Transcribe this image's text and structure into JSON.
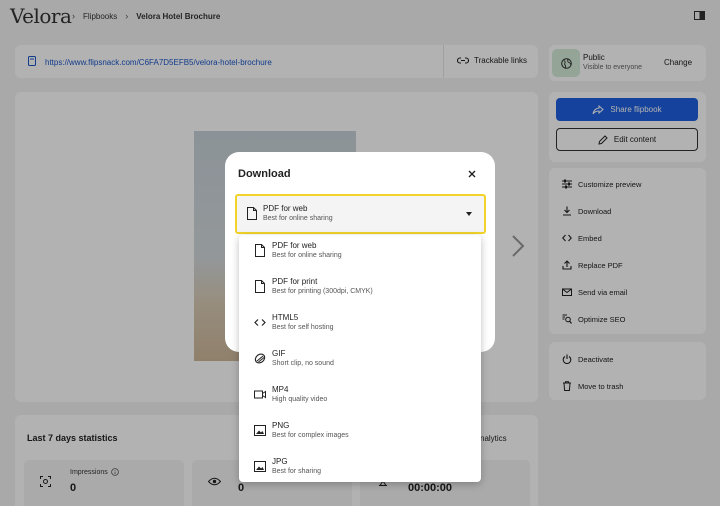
{
  "header": {
    "logo": "Velora",
    "breadcrumb": [
      "Flipbooks",
      "Velora Hotel Brochure"
    ]
  },
  "urlbar": {
    "url": "https://www.flipsnack.com/C6FA7D5EFB5/velora-hotel-brochure",
    "trackable_label": "Trackable links"
  },
  "visibility": {
    "title": "Public",
    "subtitle": "Visible to everyone",
    "change_label": "Change"
  },
  "actions": {
    "share_label": "Share flipbook",
    "edit_label": "Edit content",
    "menu": [
      {
        "label": "Customize preview",
        "icon": "sliders-icon"
      },
      {
        "label": "Download",
        "icon": "download-icon"
      },
      {
        "label": "Embed",
        "icon": "code-icon"
      },
      {
        "label": "Replace PDF",
        "icon": "upload-icon"
      },
      {
        "label": "Send via email",
        "icon": "mail-icon"
      },
      {
        "label": "Optimize SEO",
        "icon": "seo-icon"
      }
    ],
    "menu2": [
      {
        "label": "Deactivate",
        "icon": "power-icon"
      },
      {
        "label": "Move to trash",
        "icon": "trash-icon"
      }
    ]
  },
  "stats": {
    "title": "Last 7 days statistics",
    "analytics_label": "nalytics",
    "impressions_label": "Impressions",
    "impressions_value": "0",
    "views_value": "0",
    "time_value": "00:00:00"
  },
  "modal": {
    "title": "Download",
    "selected": {
      "name": "PDF for web",
      "desc": "Best for online sharing"
    },
    "options": [
      {
        "name": "PDF for web",
        "desc": "Best for online sharing",
        "icon": "document-icon"
      },
      {
        "name": "PDF for print",
        "desc": "Best for printing (300dpi, CMYK)",
        "icon": "document-icon"
      },
      {
        "name": "HTML5",
        "desc": "Best for self hosting",
        "icon": "code-icon"
      },
      {
        "name": "GIF",
        "desc": "Short clip, no sound",
        "icon": "gif-icon"
      },
      {
        "name": "MP4",
        "desc": "High quality video",
        "icon": "video-icon"
      },
      {
        "name": "PNG",
        "desc": "Best for complex images",
        "icon": "image-icon"
      },
      {
        "name": "JPG",
        "desc": "Best for sharing",
        "icon": "image-icon"
      }
    ]
  },
  "colors": {
    "accent": "#1f5fe0",
    "highlight": "#f2d32a",
    "link": "#1a56c8"
  }
}
